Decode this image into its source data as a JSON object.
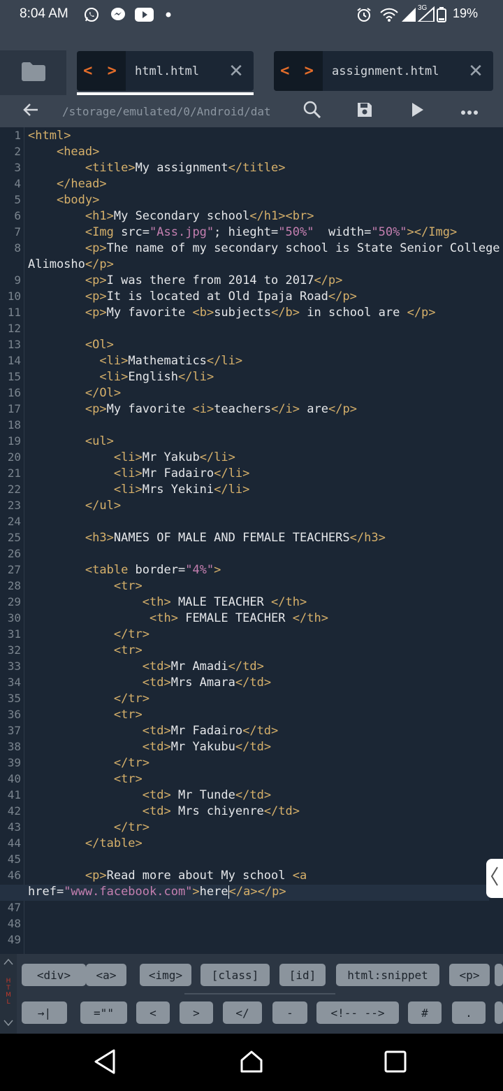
{
  "status_bar": {
    "time": "8:04 AM",
    "network": "3G",
    "battery": "19%",
    "icons": [
      "whatsapp-icon",
      "messenger-icon",
      "youtube-icon",
      "dot-icon",
      "alarm-icon",
      "wifi-icon",
      "signal-icon",
      "signal-icon",
      "battery-icon"
    ]
  },
  "tabs": [
    {
      "code_glyph": "< >",
      "name": "html.html",
      "close": "✕",
      "active": true
    },
    {
      "code_glyph": "< >",
      "name": "assignment.html",
      "close": "✕",
      "active": false
    }
  ],
  "toolbar": {
    "path": "/storage/emulated/0/Android/dat",
    "back_icon": "arrow-left-icon",
    "search_icon": "search-icon",
    "save_icon": "save-icon",
    "run_icon": "play-icon",
    "more_icon": "more-icon"
  },
  "editor": {
    "line_numbers": [
      "1",
      "2",
      "3",
      "4",
      "5",
      "6",
      "7",
      "8",
      "9",
      "10",
      "11",
      "12",
      "13",
      "14",
      "15",
      "16",
      "17",
      "18",
      "19",
      "20",
      "21",
      "22",
      "23",
      "24",
      "25",
      "26",
      "27",
      "28",
      "29",
      "30",
      "31",
      "32",
      "33",
      "34",
      "35",
      "36",
      "37",
      "38",
      "39",
      "40",
      "41",
      "42",
      "43",
      "44",
      "45",
      "46",
      "47",
      "48",
      "49"
    ],
    "current_line": 46,
    "lines": [
      "<html>",
      "    <head>",
      "        <title>My assignment</title>",
      "    </head>",
      "    <body>",
      "        <h1>My Secondary school</h1><br>",
      "        <Img src=\"Ass.jpg\"; hieght=\"50%\"  width=\"50%\"></Img>",
      "        <p>The name of my secondary school is State Senior College",
      "Alimosho</p>",
      "        <p>I was there from 2014 to 2017</p>",
      "        <p>It is located at Old Ipaja Road</p>",
      "        <p>My favorite <b>subjects</b> in school are </p>",
      "",
      "        <Ol>",
      "          <li>Mathematics</li>",
      "          <li>English</li>",
      "        </Ol>",
      "        <p>My favorite <i>teachers</i> are</p>",
      "",
      "        <ul>",
      "            <li>Mr Yakub</li>",
      "            <li>Mr Fadairo</li>",
      "            <li>Mrs Yekini</li>",
      "        </ul>",
      "",
      "        <h3>NAMES OF MALE AND FEMALE TEACHERS</h3>",
      "",
      "        <table border=\"4%\">",
      "            <tr>",
      "                <th> MALE TEACHER </th>",
      "                 <th> FEMALE TEACHER </th>",
      "            </tr>",
      "            <tr>",
      "                <td>Mr Amadi</td>",
      "                <td>Mrs Amara</td>",
      "            </tr>",
      "            <tr>",
      "                <td>Mr Fadairo</td>",
      "                <td>Mr Yakubu</td>",
      "            </tr>",
      "            <tr>",
      "                <td> Mr Tunde</td>",
      "                <td> Mrs chiyenre</td>",
      "            </tr>",
      "        </table>",
      "",
      "        <p>Read more about My school <a",
      "href=\"www.facebook.com\">here</a></p>"
    ]
  },
  "snippets": {
    "side_label": "HTML",
    "row1": [
      "<div>",
      "<a>",
      "<img>",
      "[class]",
      "[id]",
      "html:snippet",
      "<p>"
    ],
    "row2": [
      "→|",
      "=\"\"",
      "<",
      ">",
      "</",
      "-",
      "<!-- -->",
      "#",
      "."
    ]
  },
  "navbar": {
    "back_icon": "nav-back-icon",
    "home_icon": "nav-home-icon",
    "recents_icon": "nav-recents-icon"
  }
}
